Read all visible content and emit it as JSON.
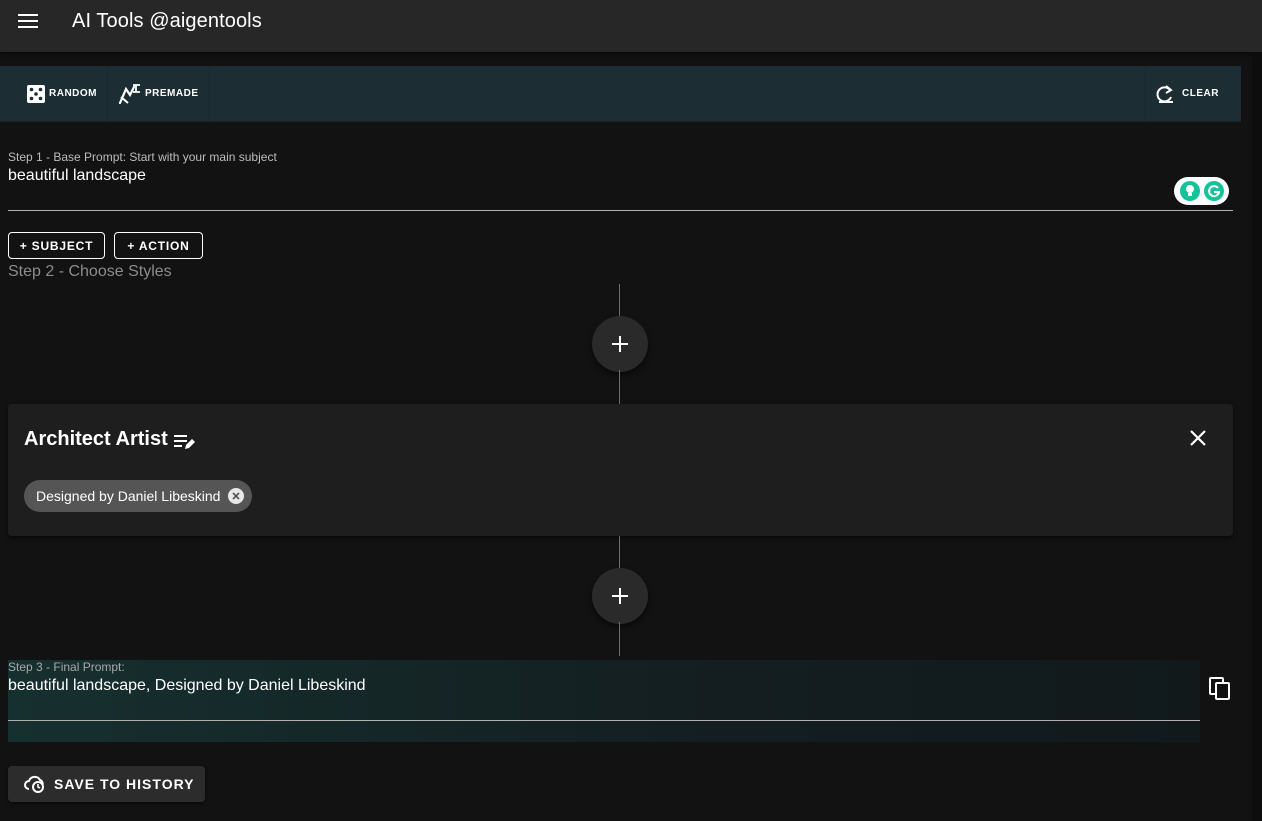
{
  "app": {
    "title": "AI Tools @aigentools"
  },
  "toolbar": {
    "random_label": "RANDOM",
    "premade_label": "PREMADE",
    "clear_label": "CLEAR"
  },
  "step1": {
    "label": "Step 1 - Base Prompt: Start with your main subject",
    "value": "beautiful landscape"
  },
  "buttons": {
    "subject_label": "+ SUBJECT",
    "action_label": "+ ACTION"
  },
  "step2": {
    "label": "Step 2 - Choose Styles"
  },
  "style_card": {
    "title": "Architect Artist",
    "chips": [
      "Designed by Daniel Libeskind"
    ]
  },
  "step3": {
    "label": "Step 3 - Final Prompt:",
    "value": "beautiful landscape, Designed by Daniel Libeskind"
  },
  "save": {
    "label": "SAVE TO HISTORY"
  },
  "colors": {
    "background": "#121212",
    "appbar": "#272727",
    "toolbar": "#1c2e34",
    "card": "#1e1e1e",
    "chip": "#555555",
    "grammarly": "#15c39a"
  },
  "icons": [
    "menu-icon",
    "dice-icon",
    "premade-icon",
    "clear-icon",
    "grammarly-bulb-icon",
    "grammarly-g-icon",
    "plus-icon",
    "edit-list-icon",
    "close-icon",
    "chip-cancel-icon",
    "copy-icon",
    "cloud-history-icon"
  ]
}
